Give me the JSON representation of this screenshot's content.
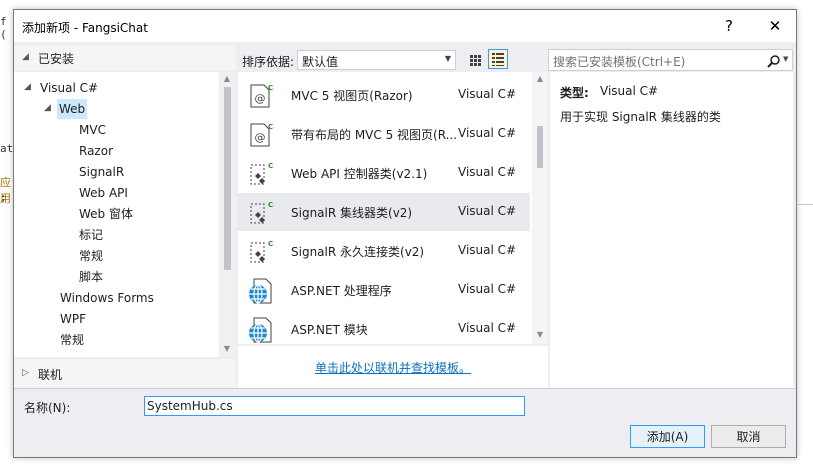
{
  "window": {
    "title": "添加新项 - FangsiChat",
    "help_label": "?",
    "close_label": "✕"
  },
  "background_code": {
    "lines": [
      "f (",
      "at",
      "应用",
      ";"
    ]
  },
  "left_panel": {
    "installed_label": "已安装",
    "tree": [
      {
        "label": "Visual C#"
      },
      {
        "label": "Web"
      },
      {
        "label": "MVC"
      },
      {
        "label": "Razor"
      },
      {
        "label": "SignalR"
      },
      {
        "label": "Web API"
      },
      {
        "label": "Web 窗体"
      },
      {
        "label": "标记"
      },
      {
        "label": "常规"
      },
      {
        "label": "脚本"
      },
      {
        "label": "Windows Forms"
      },
      {
        "label": "WPF"
      },
      {
        "label": "常规"
      }
    ],
    "online_label": "联机"
  },
  "toolbar": {
    "sort_label": "排序依据:",
    "sort_value": "默认值"
  },
  "templates": [
    {
      "name": "MVC 5 视图页(Razor)",
      "lang": "Visual C#",
      "icon": "mvc-view-icon"
    },
    {
      "name": "带有布局的 MVC 5 视图页(R...",
      "lang": "Visual C#",
      "icon": "mvc-layout-view-icon"
    },
    {
      "name": "Web API 控制器类(v2.1)",
      "lang": "Visual C#",
      "icon": "csharp-class-icon"
    },
    {
      "name": "SignalR 集线器类(v2)",
      "lang": "Visual C#",
      "icon": "csharp-class-icon"
    },
    {
      "name": "SignalR 永久连接类(v2)",
      "lang": "Visual C#",
      "icon": "csharp-class-icon"
    },
    {
      "name": "ASP.NET 处理程序",
      "lang": "Visual C#",
      "icon": "globe-icon"
    },
    {
      "name": "ASP.NET 模块",
      "lang": "Visual C#",
      "icon": "globe-icon"
    }
  ],
  "online_link": "单击此处以联机并查找模板。",
  "search": {
    "placeholder": "搜索已安装模板(Ctrl+E)"
  },
  "details": {
    "type_label": "类型:",
    "type_value": "Visual C#",
    "description": "用于实现 SignalR 集线器的类"
  },
  "name_field": {
    "label": "名称(N):",
    "value": "SystemHub.cs"
  },
  "buttons": {
    "add": "添加(A)",
    "cancel": "取消"
  },
  "colors": {
    "accent": "#3399ff",
    "selection": "#cce8ff",
    "link": "#0e70c0",
    "dialog_bg": "#eeeef2"
  }
}
